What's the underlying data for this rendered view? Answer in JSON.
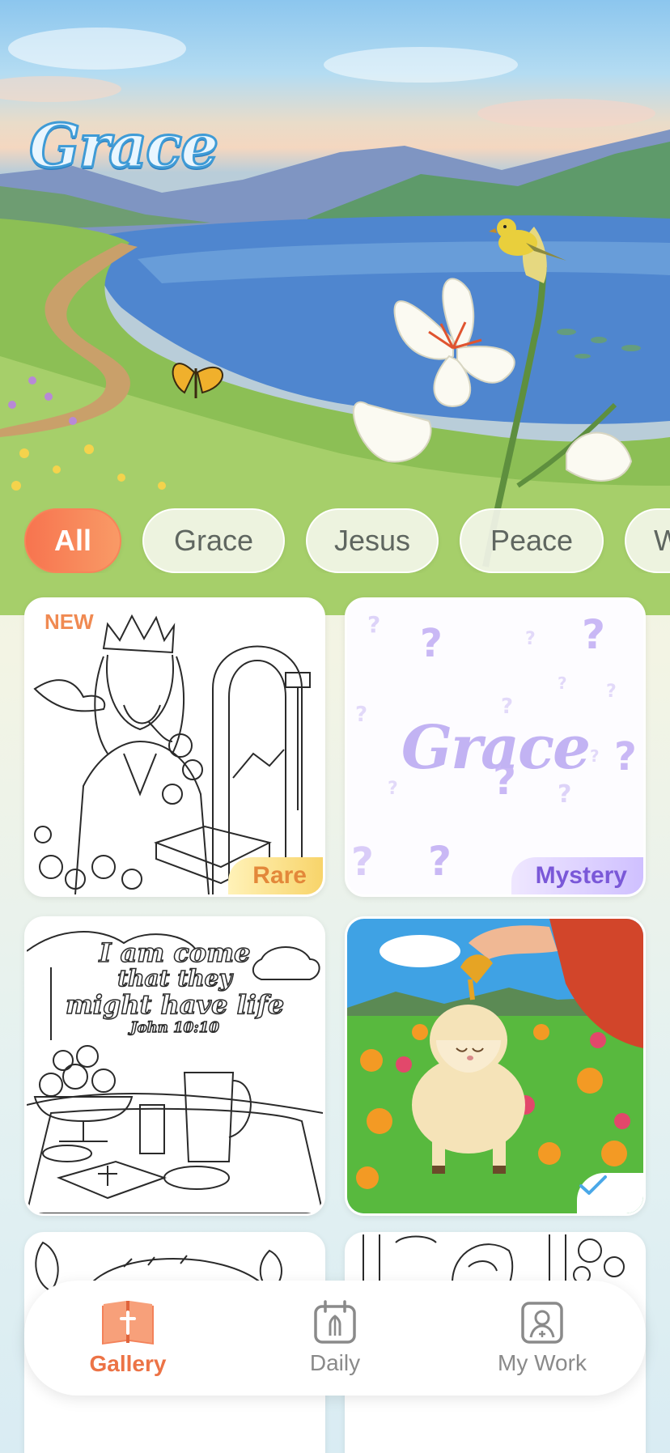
{
  "app": {
    "brand": "Grace"
  },
  "filters": {
    "chips": [
      {
        "label": "All",
        "active": true
      },
      {
        "label": "Grace",
        "active": false
      },
      {
        "label": "Jesus",
        "active": false
      },
      {
        "label": "Peace",
        "active": false
      },
      {
        "label": "W",
        "active": false
      }
    ]
  },
  "gallery": {
    "cards": [
      {
        "tag": "NEW",
        "badge": "Rare",
        "subject": "king-jesus-coloring"
      },
      {
        "title": "Grace",
        "badge": "Mystery",
        "subject": "mystery-card"
      },
      {
        "quote_line1": "I am come",
        "quote_line2": "that they",
        "quote_line3": "might have life",
        "reference": "John 10:10",
        "subject": "table-still-life-coloring"
      },
      {
        "subject": "anointed-lamb-colored",
        "completed": true
      },
      {
        "subject": "butterflies-arch-coloring"
      },
      {
        "subject": "mary-window-coloring"
      }
    ]
  },
  "nav": {
    "items": [
      {
        "label": "Gallery",
        "icon": "bible-icon",
        "active": true
      },
      {
        "label": "Daily",
        "icon": "calendar-praying-hands-icon",
        "active": false
      },
      {
        "label": "My Work",
        "icon": "profile-frame-icon",
        "active": false
      }
    ]
  },
  "colors": {
    "accent": "#f7744f",
    "rare_badge": "#f8d46a",
    "mystery_badge": "#cfc0ff",
    "check": "#4aa8e8"
  }
}
